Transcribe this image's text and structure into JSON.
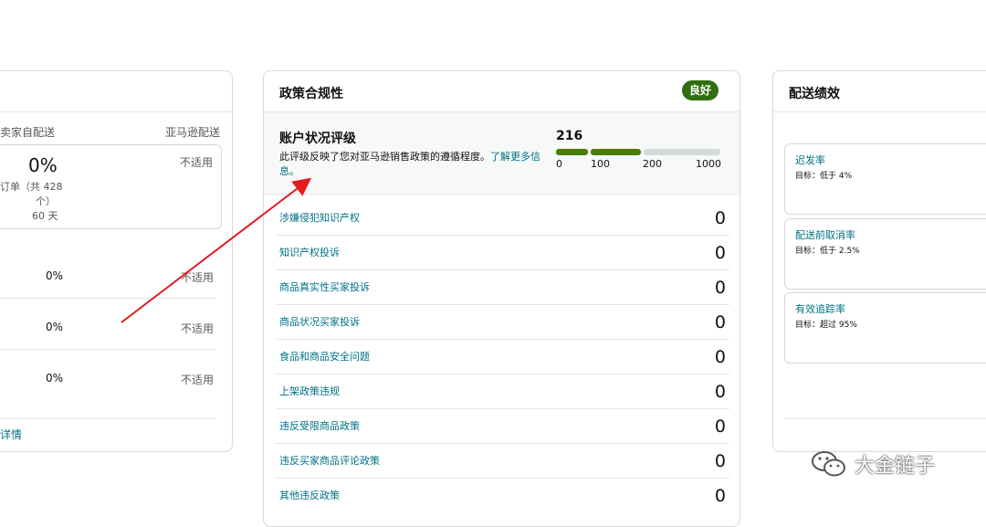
{
  "left_card": {
    "col_seller": "卖家自配送",
    "col_amazon": "亚马逊配送",
    "summary": {
      "percent": "0%",
      "orders_text": "订单（共 428",
      "orders_text2": "个）",
      "days_text": "60 天",
      "not_applicable": "不适用"
    },
    "rows": [
      {
        "percent": "0%",
        "na": "不适用"
      },
      {
        "percent": "0%",
        "na": "不适用"
      },
      {
        "percent": "0%",
        "na": "不适用"
      }
    ],
    "details_link": "详情"
  },
  "policy_card": {
    "title": "政策合规性",
    "status_badge": "良好",
    "account_health": {
      "title": "账户状况评级",
      "description": "此评级反映了您对亚马逊销售政策的遵循程度。",
      "learn_more": "了解更多信息。",
      "score": "216",
      "ticks": [
        "0",
        "100",
        "200",
        "1000"
      ],
      "colors": {
        "good": "#4b7b08",
        "empty": "#d5d9d9"
      }
    },
    "violations": [
      {
        "label": "涉嫌侵犯知识产权",
        "count": "0"
      },
      {
        "label": "知识产权投诉",
        "count": "0"
      },
      {
        "label": "商品真实性买家投诉",
        "count": "0"
      },
      {
        "label": "商品状况买家投诉",
        "count": "0"
      },
      {
        "label": "食品和商品安全问题",
        "count": "0"
      },
      {
        "label": "上架政策违规",
        "count": "0"
      },
      {
        "label": "违反受限商品政策",
        "count": "0"
      },
      {
        "label": "违反买家商品评论政策",
        "count": "0"
      },
      {
        "label": "其他违反政策",
        "count": "0"
      }
    ]
  },
  "shipping_card": {
    "title": "配送绩效",
    "metrics": [
      {
        "name": "迟发率",
        "target": "目标：低于 4%"
      },
      {
        "name": "配送前取消率",
        "target": "目标：低于 2.5%"
      },
      {
        "name": "有效追踪率",
        "target": "目标：超过 95%"
      }
    ]
  },
  "watermark": {
    "text": "大金链子",
    "icon": "wechat-icon"
  },
  "annotation": {
    "arrow_color": "#e31b1b"
  }
}
